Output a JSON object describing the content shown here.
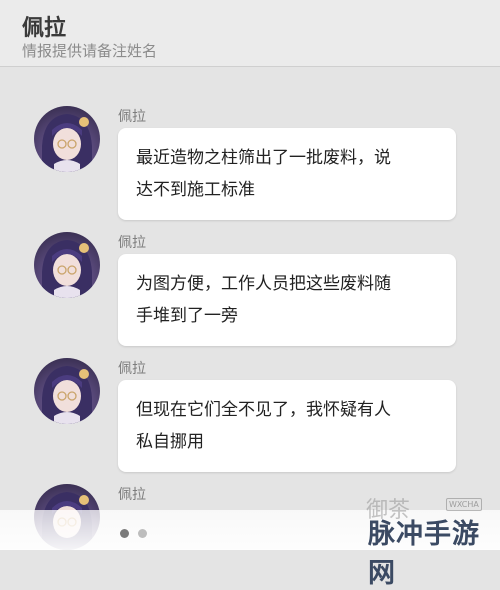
{
  "header": {
    "name": "佩拉",
    "subtitle": "情报提供请备注姓名"
  },
  "messages": [
    {
      "sender": "佩拉",
      "lines": [
        "最近造物之柱筛出了一批废料，说",
        "达不到施工标准"
      ]
    },
    {
      "sender": "佩拉",
      "lines": [
        "为图方便，工作人员把这些废料随",
        "手堆到了一旁"
      ]
    },
    {
      "sender": "佩拉",
      "lines": [
        "但现在它们全不见了，我怀疑有人",
        "私自挪用"
      ]
    },
    {
      "sender": "佩拉"
    }
  ],
  "watermark": {
    "text": "御茶",
    "badge": "WXCHA"
  },
  "site_logo": "脉冲手游网"
}
